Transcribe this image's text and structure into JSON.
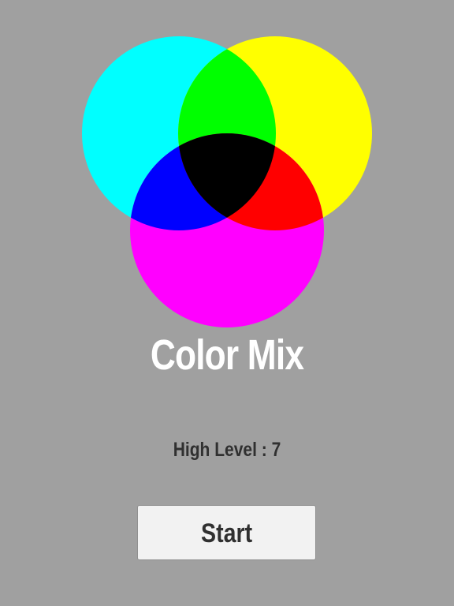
{
  "game": {
    "title": "Color Mix",
    "high_level_text": "High Level : 7",
    "start_label": "Start"
  },
  "colors": {
    "background": "#a0a0a0",
    "cyan": "#00ffff",
    "yellow": "#ffff00",
    "magenta": "#ff00ff",
    "green": "#00ff00",
    "blue": "#0000ff",
    "red": "#ff0000",
    "black": "#000000",
    "title": "#ffffff",
    "text": "#303030"
  }
}
